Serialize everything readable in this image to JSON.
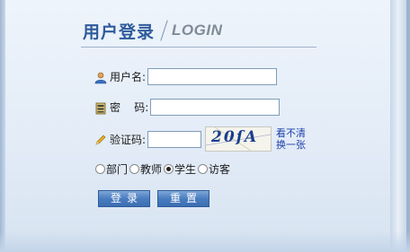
{
  "header": {
    "title_cn": "用户登录",
    "title_en": "LOGIN"
  },
  "form": {
    "username": {
      "label": "用户名:",
      "value": ""
    },
    "password": {
      "label": "密    码:",
      "value": ""
    },
    "captcha": {
      "label": "验证码:",
      "value": "",
      "image_text": "20ſA",
      "refresh_line1": "看不清",
      "refresh_line2": "换一张"
    },
    "roles": [
      {
        "label": "部门",
        "checked": false
      },
      {
        "label": "教师",
        "checked": false
      },
      {
        "label": "学生",
        "checked": true
      },
      {
        "label": "访客",
        "checked": false
      }
    ]
  },
  "buttons": {
    "login": "登录",
    "reset": "重置"
  },
  "icons": {
    "username": "user-icon",
    "password": "lock-icon",
    "captcha": "pencil-icon"
  },
  "colors": {
    "title": "#2e5b9b",
    "button": "#4a7dc0",
    "link": "#1d3fa8"
  }
}
